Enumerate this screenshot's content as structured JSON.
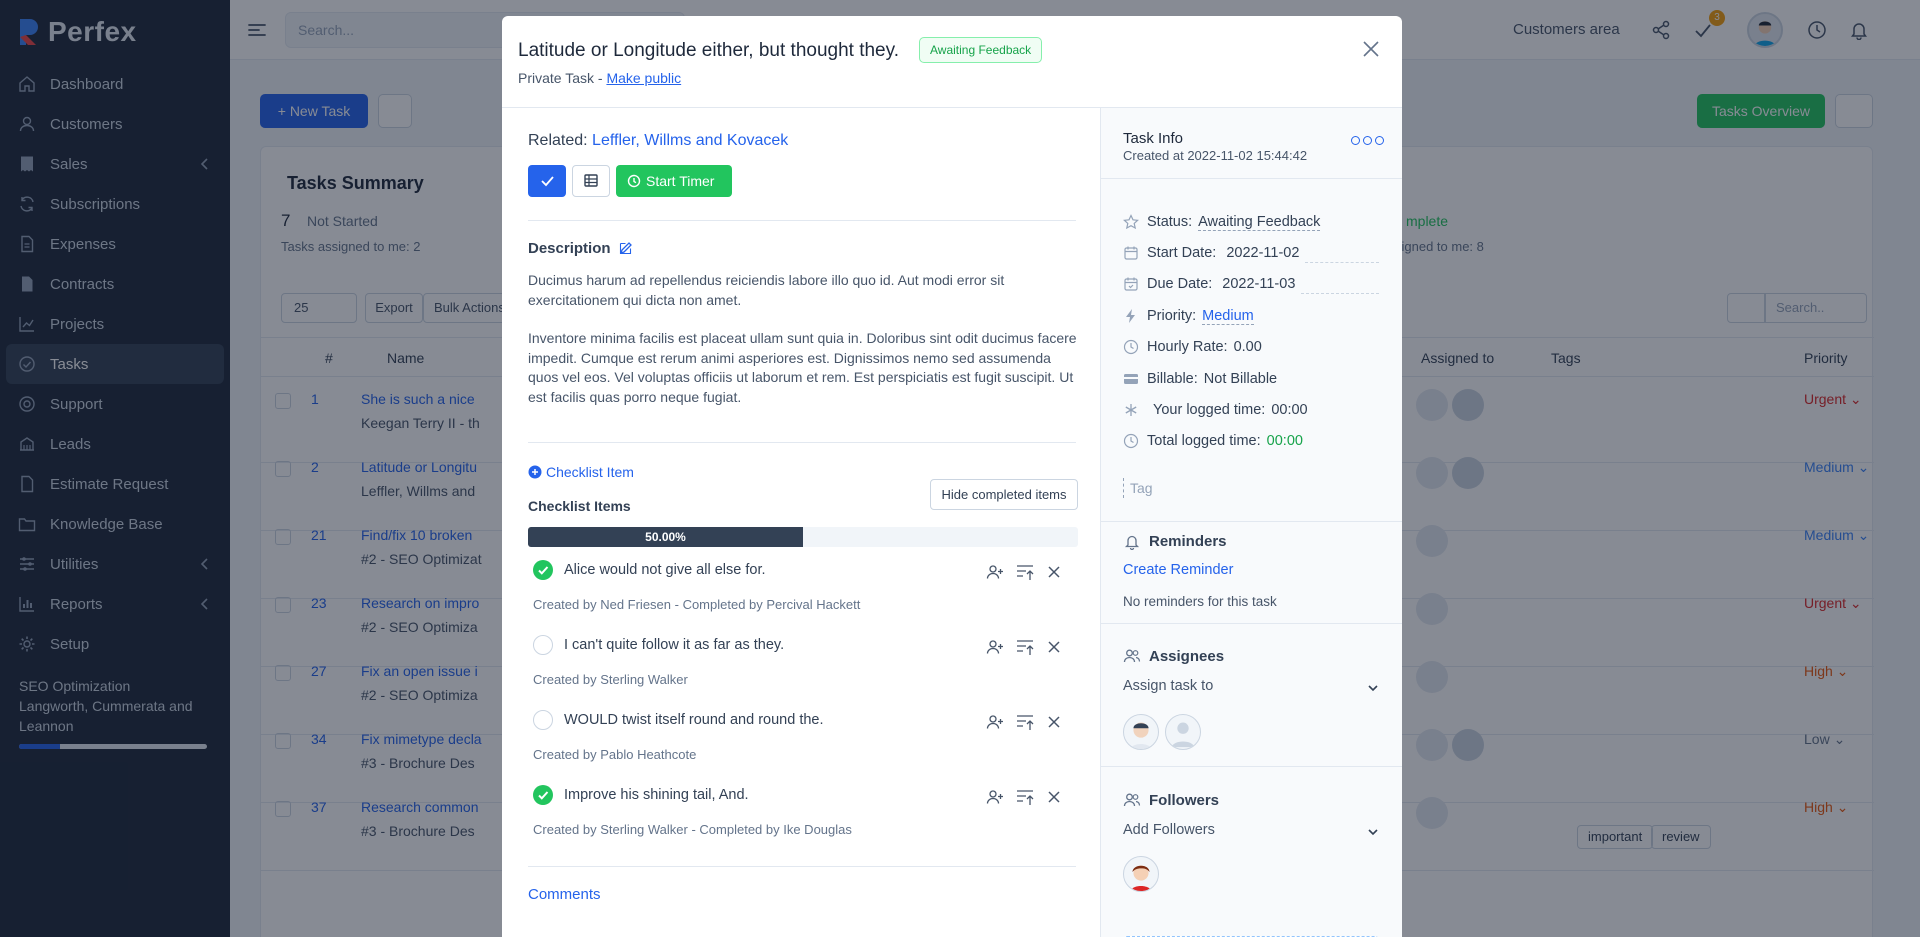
{
  "app": {
    "name": "Perfex"
  },
  "sidebar": {
    "items": [
      {
        "label": "Dashboard",
        "icon": "home-icon"
      },
      {
        "label": "Customers",
        "icon": "user-icon"
      },
      {
        "label": "Sales",
        "icon": "receipt-icon",
        "submenu": true
      },
      {
        "label": "Subscriptions",
        "icon": "refresh-icon"
      },
      {
        "label": "Expenses",
        "icon": "document-icon"
      },
      {
        "label": "Contracts",
        "icon": "contract-icon"
      },
      {
        "label": "Projects",
        "icon": "chart-icon"
      },
      {
        "label": "Tasks",
        "icon": "check-circle-icon",
        "active": true
      },
      {
        "label": "Support",
        "icon": "lifebuoy-icon"
      },
      {
        "label": "Leads",
        "icon": "leads-icon"
      },
      {
        "label": "Estimate Request",
        "icon": "file-icon"
      },
      {
        "label": "Knowledge Base",
        "icon": "folder-icon"
      },
      {
        "label": "Utilities",
        "icon": "sliders-icon",
        "submenu": true
      },
      {
        "label": "Reports",
        "icon": "bar-chart-icon",
        "submenu": true
      },
      {
        "label": "Setup",
        "icon": "gear-icon"
      }
    ],
    "project": {
      "name": "SEO Optimization",
      "client_line1": "Langworth, Cummerata and",
      "client_line2": "Leannon",
      "progress": 0.22
    }
  },
  "topbar": {
    "search_placeholder": "Search...",
    "customers_area": "Customers area",
    "todo_badge": "3"
  },
  "page": {
    "new_task": "New Task",
    "tasks_overview": "Tasks Overview",
    "summary_title": "Tasks Summary",
    "not_started_count": "7",
    "not_started_label": "Not Started",
    "assigned_to_me_left": "Tasks assigned to me: 2",
    "complete_label": "mplete",
    "assigned_to_me_right": "signed to me: 8",
    "page_size": "25",
    "export": "Export",
    "bulk_actions": "Bulk Actions",
    "search_placeholder": "Search..",
    "columns": {
      "num": "#",
      "name": "Name",
      "assigned": "Assigned to",
      "tags": "Tags",
      "priority": "Priority"
    },
    "rows": [
      {
        "num": "1",
        "name": "She is such a nice",
        "sub": "Keegan Terry II - th",
        "priority": "Urgent",
        "priority_color": "#dc2626"
      },
      {
        "num": "2",
        "name": "Latitude or Longitu",
        "sub": "Leffler, Willms and",
        "priority": "Medium",
        "priority_color": "#3b82f6"
      },
      {
        "num": "21",
        "name": "Find/fix 10 broken",
        "sub": "#2 - SEO Optimizat",
        "priority": "Medium",
        "priority_color": "#3b82f6"
      },
      {
        "num": "23",
        "name": "Research on impro",
        "sub": "#2 - SEO Optimiza",
        "priority": "Urgent",
        "priority_color": "#dc2626"
      },
      {
        "num": "27",
        "name": "Fix an open issue i",
        "sub": "#2 - SEO Optimiza",
        "priority": "High",
        "priority_color": "#ea580c"
      },
      {
        "num": "34",
        "name": "Fix mimetype decla",
        "sub": "#3 - Brochure Des",
        "priority": "Low",
        "priority_color": "#64748b"
      },
      {
        "num": "37",
        "name": "Research common",
        "sub": "#3 - Brochure Des",
        "priority": "High",
        "priority_color": "#ea580c",
        "tags": [
          "important",
          "review"
        ]
      }
    ]
  },
  "modal": {
    "title": "Latitude or Longitude either, but thought they.",
    "status": "Awaiting Feedback",
    "privacy_prefix": "Private Task - ",
    "make_public": "Make public",
    "related_label": "Related:",
    "related_value": "Leffler, Willms and Kovacek",
    "start_timer": "Start Timer",
    "description_label": "Description",
    "description_p1": "Ducimus harum ad repellendus reiciendis labore illo quo id. Aut modi error sit exercitationem qui dicta non amet.",
    "description_p2": "Inventore minima facilis est placeat ullam sunt quia in. Doloribus sint odit ducimus facere impedit. Cumque est rerum animi asperiores est. Dignissimos nemo sed assumenda quos vel eos. Vel voluptas officiis ut laborum et rem. Est perspiciatis est fugit suscipit. Ut est facilis quas porro neque fugiat.",
    "add_checklist": "Checklist Item",
    "checklist_title": "Checklist Items",
    "hide_completed": "Hide completed items",
    "progress_label": "50.00%",
    "progress": 0.5,
    "checklist": [
      {
        "text": "Alice would not give all else for.",
        "meta": "Created by Ned Friesen - Completed by Percival Hackett",
        "done": true
      },
      {
        "text": "I can't quite follow it as far as they.",
        "meta": "Created by Sterling Walker",
        "done": false
      },
      {
        "text": "WOULD twist itself round and round the.",
        "meta": "Created by Pablo Heathcote",
        "done": false
      },
      {
        "text": "Improve his shining tail, And.",
        "meta": "Created by Sterling Walker - Completed by Ike Douglas",
        "done": true
      }
    ],
    "comments": "Comments"
  },
  "task_info": {
    "title": "Task Info",
    "created": "Created at 2022-11-02 15:44:42",
    "status_label": "Status:",
    "status_value": "Awaiting Feedback",
    "start_label": "Start Date:",
    "start_value": "2022-11-02",
    "due_label": "Due Date:",
    "due_value": "2022-11-03",
    "priority_label": "Priority:",
    "priority_value": "Medium",
    "rate_label": "Hourly Rate:",
    "rate_value": "0.00",
    "billable_label": "Billable:",
    "billable_value": "Not Billable",
    "logged_label": "Your logged time:",
    "logged_value": "00:00",
    "total_label": "Total logged time:",
    "total_value": "00:00",
    "tag_placeholder": "Tag",
    "reminders_title": "Reminders",
    "create_reminder": "Create Reminder",
    "no_reminders": "No reminders for this task",
    "assignees_title": "Assignees",
    "assign_placeholder": "Assign task to",
    "followers_title": "Followers",
    "followers_placeholder": "Add Followers"
  }
}
